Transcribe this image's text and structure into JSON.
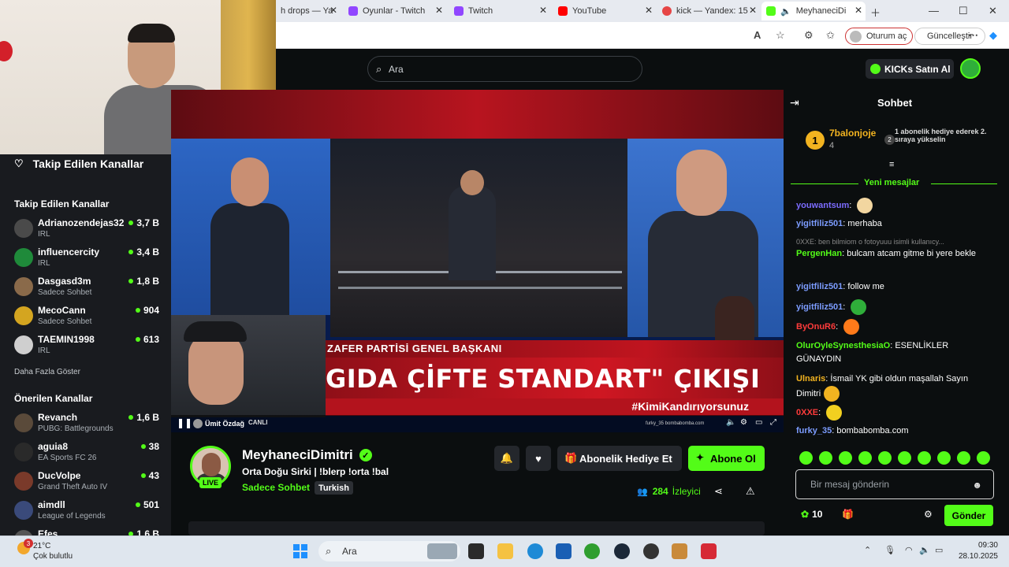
{
  "browser": {
    "tabs": [
      {
        "label": "h drops — Ya"
      },
      {
        "label": "Oyunlar - Twitch"
      },
      {
        "label": "Twitch"
      },
      {
        "label": "YouTube"
      },
      {
        "label": "kick — Yandex: 15"
      },
      {
        "label": "MeyhaneciDi"
      }
    ],
    "signin_label": "Oturum aç",
    "update_label": "Güncelleştir",
    "read_aloud_label": "A"
  },
  "topnav": {
    "search_placeholder": "Ara",
    "kicks_button": "KICKs Satın Al"
  },
  "sidebar": {
    "followed_header": "Takip Edilen Kanallar",
    "followed_title": "Takip Edilen Kanallar",
    "followed": [
      {
        "name": "Adrianozendejas32",
        "category": "IRL",
        "viewers": "3,7 B",
        "avatar_color": "#4a4a4a"
      },
      {
        "name": "influencercity",
        "category": "IRL",
        "viewers": "3,4 B",
        "avatar_color": "#1f8a3a"
      },
      {
        "name": "Dasgasd3m",
        "category": "Sadece Sohbet",
        "viewers": "1,8 B",
        "avatar_color": "#8a6a4a"
      },
      {
        "name": "MecoCann",
        "category": "Sadece Sohbet",
        "viewers": "904",
        "avatar_color": "#d4a520"
      },
      {
        "name": "TAEMIN1998",
        "category": "IRL",
        "viewers": "613",
        "avatar_color": "#cfcfcf"
      }
    ],
    "more_link": "Daha Fazla Göster",
    "recommended_title": "Önerilen Kanallar",
    "recommended": [
      {
        "name": "Revanch",
        "category": "PUBG: Battlegrounds",
        "viewers": "1,6 B",
        "avatar_color": "#5a4a3a"
      },
      {
        "name": "aguia8",
        "category": "EA Sports FC 26",
        "viewers": "38",
        "avatar_color": "#2a2a2a"
      },
      {
        "name": "DucVolpe",
        "category": "Grand Theft Auto IV",
        "viewers": "43",
        "avatar_color": "#7a3a2a"
      },
      {
        "name": "aimdll",
        "category": "League of Legends",
        "viewers": "501",
        "avatar_color": "#3a4a7a"
      },
      {
        "name": "Efes",
        "category": "",
        "viewers": "1,6 B",
        "avatar_color": "#555555"
      }
    ]
  },
  "player": {
    "lower_third": "ZAFER PARTİSİ GENEL BAŞKANI",
    "headline": "GIDA ÇİFTE STANDART\" ÇIKIŞI",
    "hashtag": "#KimiKandırıyorsunuz",
    "control_title": "Ümit Özdağ",
    "control_live": "CANLI",
    "watermark": "furky_35  bombabomba.com"
  },
  "channel": {
    "name": "MeyhaneciDimitri",
    "live_badge": "LIVE",
    "title": "Orta Doğu Sirki | !blerp !orta !bal",
    "category": "Sadece Sohbet",
    "language": "Turkish",
    "gift_button": "Abonelik Hediye Et",
    "subscribe_button": "Abone Ol",
    "viewers_count": "284",
    "viewers_label": "İzleyici"
  },
  "chat": {
    "header": "Sohbet",
    "pinned": {
      "rank": "1",
      "user": "7balonjoje",
      "count": "4",
      "position_badge": "2",
      "text": "1 abonelik hediye ederek 2. sıraya yükselin"
    },
    "new_messages_label": "Yeni mesajlar",
    "messages": [
      {
        "user": "youwantsum",
        "color": "#7c6cff",
        "text": ""
      },
      {
        "user": "yigitfiliz501",
        "color": "#7c9cff",
        "text": "merhaba"
      },
      {
        "user": "PergenHan",
        "color": "#53fc18",
        "text": "bulcam atcam gitme bi yere bekle"
      },
      {
        "user": "yigitfiliz501",
        "color": "#7c9cff",
        "text": "follow me"
      },
      {
        "user": "yigitfiliz501",
        "color": "#7c9cff",
        "text": ""
      },
      {
        "user": "ByOnuR6",
        "color": "#ff3b3b",
        "text": ""
      },
      {
        "user": "OlurOyleSynesthesiaO",
        "color": "#53fc18",
        "text": "ESENLİKLER GÜNAYDIN"
      },
      {
        "user": "Ulnaris",
        "color": "#f2b320",
        "text": "İsmail YK gibi oldun maşallah Sayın Dimitri"
      },
      {
        "user": "0XXE",
        "color": "#ff3b3b",
        "text": ""
      },
      {
        "user": "furky_35",
        "color": "#7c9cff",
        "text": "bombabomba.com"
      }
    ],
    "reply_preview": "0XXE: ben bilmiom o fotoyuuu isimli kullanıcy...",
    "input_placeholder": "Bir mesaj gönderin",
    "points": "10",
    "send_button": "Gönder"
  },
  "taskbar": {
    "weather_temp": "21°C",
    "weather_desc": "Çok bulutlu",
    "weather_badge": "3",
    "search_label": "Ara",
    "time": "09:30",
    "date": "28.10.2025"
  }
}
